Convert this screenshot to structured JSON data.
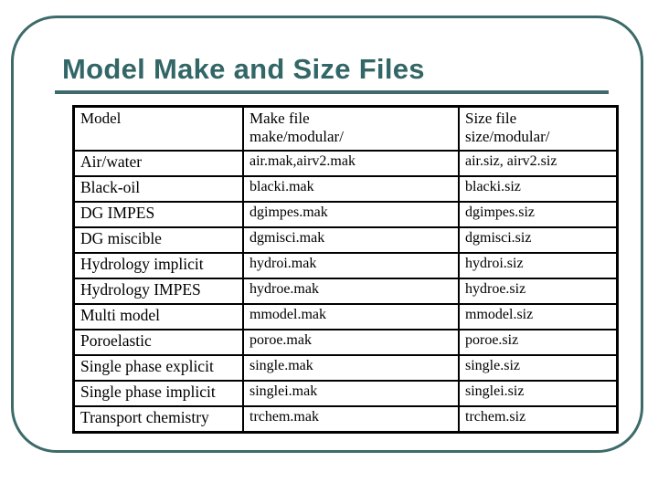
{
  "slide": {
    "title": "Model Make and Size Files",
    "accent_color": "#336666"
  },
  "table": {
    "headers": [
      {
        "line1": "Model",
        "line2": ""
      },
      {
        "line1": "Make file",
        "line2": "make/modular/"
      },
      {
        "line1": "Size file",
        "line2": "size/modular/"
      }
    ],
    "rows": [
      {
        "model": "Air/water",
        "make": "air.mak,airv2.mak",
        "size": "air.siz, airv2.siz"
      },
      {
        "model": "Black-oil",
        "make": "blacki.mak",
        "size": "blacki.siz"
      },
      {
        "model": "DG IMPES",
        "make": "dgimpes.mak",
        "size": "dgimpes.siz"
      },
      {
        "model": "DG miscible",
        "make": "dgmisci.mak",
        "size": "dgmisci.siz"
      },
      {
        "model": "Hydrology implicit",
        "make": "hydroi.mak",
        "size": "hydroi.siz"
      },
      {
        "model": "Hydrology IMPES",
        "make": "hydroe.mak",
        "size": "hydroe.siz"
      },
      {
        "model": "Multi model",
        "make": "mmodel.mak",
        "size": "mmodel.siz"
      },
      {
        "model": "Poroelastic",
        "make": "poroe.mak",
        "size": "poroe.siz"
      },
      {
        "model": "Single phase explicit",
        "make": "single.mak",
        "size": "single.siz"
      },
      {
        "model": "Single phase implicit",
        "make": "singlei.mak",
        "size": "singlei.siz"
      },
      {
        "model": "Transport chemistry",
        "make": "trchem.mak",
        "size": "trchem.siz"
      }
    ]
  }
}
